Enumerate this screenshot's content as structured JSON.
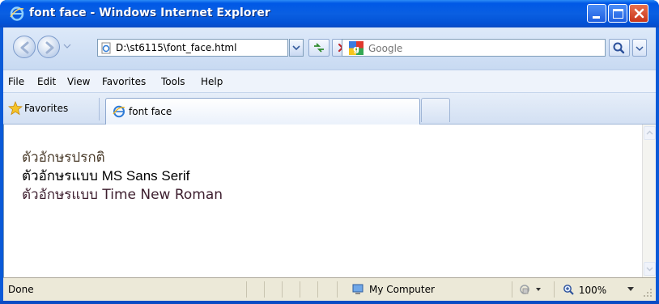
{
  "window": {
    "title": "font face - Windows Internet Explorer"
  },
  "address_bar": {
    "url": "D:\\st6115\\font_face.html"
  },
  "search": {
    "placeholder": "Google"
  },
  "menu": {
    "items": [
      "File",
      "Edit",
      "View",
      "Favorites",
      "Tools",
      "Help"
    ]
  },
  "favorites_bar": {
    "label": "Favorites"
  },
  "tabs": [
    {
      "label": "font face"
    }
  ],
  "content": {
    "lines": [
      "ตัวอักษรปรกติ",
      "ตัวอักษรแบบ MS Sans Serif",
      "ตัวอักษรแบบ Time New Roman"
    ]
  },
  "status": {
    "text": "Done",
    "zone": "My Computer",
    "zoom": "100%"
  },
  "icons": {
    "titlebar": "ie-logo-icon",
    "back": "back-arrow-icon",
    "forward": "forward-arrow-icon",
    "refresh": "refresh-icon",
    "stop": "stop-icon",
    "search": "magnifier-icon",
    "favorites": "star-icon",
    "zone": "computer-icon",
    "zoom": "magnifier-plus-icon"
  },
  "colors": {
    "titlebar": "#0058e6",
    "close_button": "#c9351a"
  }
}
